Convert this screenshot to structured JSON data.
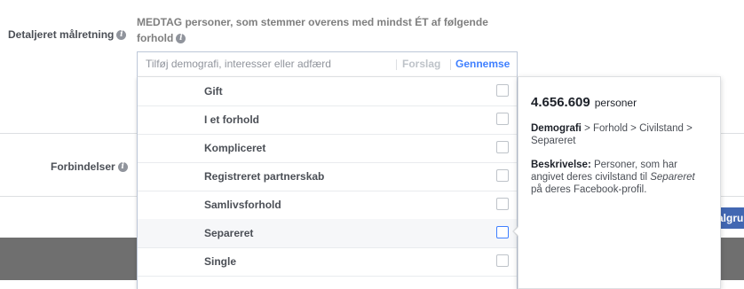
{
  "colors": {
    "accent": "#4080ff",
    "button": "#4267b2",
    "footer": "#6f6f6f",
    "label": "#4b4f56"
  },
  "targeting": {
    "label": "Detaljeret målretning",
    "info_icon": "info-icon",
    "include_header": "MEDTAG personer, som stemmer overens med mindst ÉT af følgende",
    "include_header_line2": "forhold"
  },
  "search": {
    "placeholder": "Tilføj demografi, interesser eller adfærd",
    "tab_suggestions": "Forslag",
    "tab_browse": "Gennemse"
  },
  "dropdown": {
    "options": [
      {
        "label": "Gift",
        "checked": false,
        "highlighted": false
      },
      {
        "label": "I et forhold",
        "checked": false,
        "highlighted": false
      },
      {
        "label": "Kompliceret",
        "checked": false,
        "highlighted": false
      },
      {
        "label": "Registreret partnerskab",
        "checked": false,
        "highlighted": false
      },
      {
        "label": "Samlivsforhold",
        "checked": false,
        "highlighted": false
      },
      {
        "label": "Separeret",
        "checked": false,
        "highlighted": true
      },
      {
        "label": "Single",
        "checked": false,
        "highlighted": false
      }
    ]
  },
  "detail": {
    "audience_count": "4.656.609",
    "audience_unit": "personer",
    "path_label": "Demografi",
    "path_rest": " > Forhold > Civilstand > Separeret",
    "desc_label": "Beskrivelse:",
    "desc_text_1": " Personer, som har angivet deres civilstand til ",
    "desc_italic": "Separeret",
    "desc_text_2": " på deres Facebook-profil."
  },
  "connections": {
    "label": "Forbindelser"
  },
  "button": {
    "label": "algru"
  }
}
